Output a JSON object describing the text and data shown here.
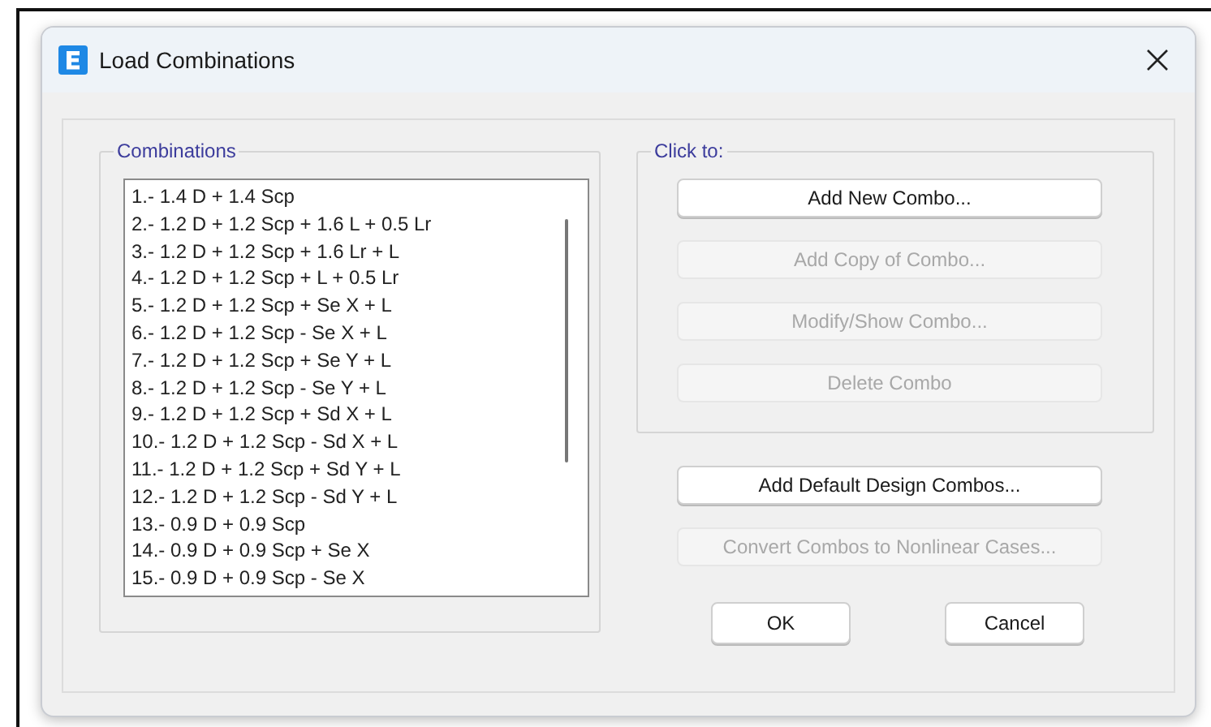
{
  "window": {
    "title": "Load Combinations"
  },
  "combinations": {
    "label": "Combinations",
    "items": [
      "1.- 1.4 D + 1.4 Scp",
      "2.- 1.2 D + 1.2 Scp + 1.6 L + 0.5 Lr",
      "3.- 1.2 D + 1.2 Scp + 1.6 Lr + L",
      "4.- 1.2 D + 1.2 Scp + L + 0.5 Lr",
      "5.- 1.2 D + 1.2 Scp + Se X + L",
      "6.- 1.2 D + 1.2 Scp - Se X + L",
      "7.- 1.2 D + 1.2 Scp + Se Y + L",
      "8.- 1.2 D + 1.2 Scp - Se Y + L",
      "9.- 1.2 D + 1.2 Scp + Sd X + L",
      "10.- 1.2 D + 1.2 Scp - Sd X + L",
      "11.- 1.2 D + 1.2 Scp + Sd Y + L",
      "12.- 1.2 D + 1.2 Scp - Sd Y + L",
      "13.- 0.9 D + 0.9 Scp",
      "14.- 0.9 D + 0.9 Scp + Se X",
      "15.- 0.9 D + 0.9 Scp - Se X"
    ]
  },
  "click_to": {
    "label": "Click to:",
    "buttons": [
      {
        "label": "Add New Combo...",
        "disabled": false
      },
      {
        "label": "Add Copy of Combo...",
        "disabled": true
      },
      {
        "label": "Modify/Show Combo...",
        "disabled": true
      },
      {
        "label": "Delete Combo",
        "disabled": true
      }
    ]
  },
  "extra_buttons": [
    {
      "label": "Add Default Design Combos...",
      "disabled": false
    },
    {
      "label": "Convert Combos to Nonlinear Cases...",
      "disabled": true
    }
  ],
  "buttons": [
    {
      "label": "OK"
    },
    {
      "label": "Cancel"
    }
  ]
}
